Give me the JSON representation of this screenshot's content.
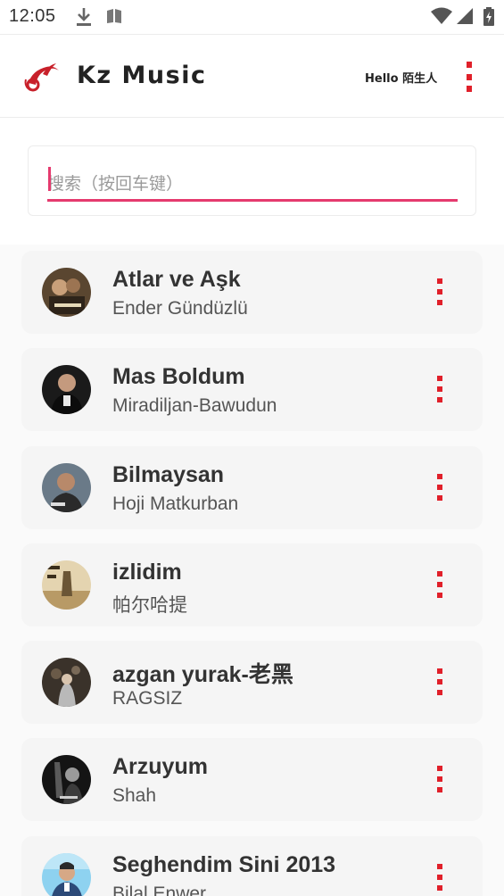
{
  "status_bar": {
    "time": "12:05",
    "icons": [
      "download-icon",
      "book-icon",
      "wifi-icon",
      "signal-icon",
      "battery-icon"
    ]
  },
  "header": {
    "app_title": "Kz Music",
    "greeting": "Hello 陌生人",
    "logo_icon": "music-note-logo-icon",
    "menu_icon": "more-vertical-icon"
  },
  "search": {
    "placeholder": "搜索（按回车键）",
    "value": ""
  },
  "colors": {
    "accent": "#e0202a",
    "search_underline": "#e53a6e",
    "card_bg": "#f5f5f5",
    "page_bg": "#fafafa"
  },
  "songs": [
    {
      "title": "Atlar ve Aşk",
      "artist": "Ender Gündüzlü"
    },
    {
      "title": "Mas Boldum",
      "artist": "Miradiljan-Bawudun"
    },
    {
      "title": "Bilmaysan",
      "artist": "Hoji Matkurban"
    },
    {
      "title": "izlidim",
      "artist": "帕尔哈提"
    },
    {
      "title": "azgan yurak-老黑",
      "artist": "RAGSIZ"
    },
    {
      "title": "Arzuyum",
      "artist": "Shah"
    },
    {
      "title": "Seghendim Sini 2013",
      "artist": "Bilal Enwer"
    }
  ]
}
